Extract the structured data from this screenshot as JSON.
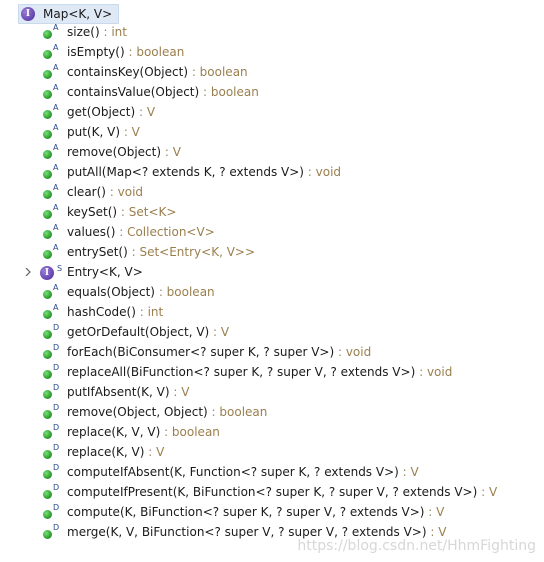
{
  "root": {
    "label": "Map<K, V>",
    "icon": "interface-icon"
  },
  "members": [
    {
      "badge": "A",
      "name": "size()",
      "sep": " : ",
      "type": "int",
      "kind": "method"
    },
    {
      "badge": "A",
      "name": "isEmpty()",
      "sep": " : ",
      "type": "boolean",
      "kind": "method"
    },
    {
      "badge": "A",
      "name": "containsKey(Object)",
      "sep": " : ",
      "type": "boolean",
      "kind": "method"
    },
    {
      "badge": "A",
      "name": "containsValue(Object)",
      "sep": " : ",
      "type": "boolean",
      "kind": "method"
    },
    {
      "badge": "A",
      "name": "get(Object)",
      "sep": " : ",
      "type": "V",
      "kind": "method"
    },
    {
      "badge": "A",
      "name": "put(K, V)",
      "sep": " : ",
      "type": "V",
      "kind": "method"
    },
    {
      "badge": "A",
      "name": "remove(Object)",
      "sep": " : ",
      "type": "V",
      "kind": "method"
    },
    {
      "badge": "A",
      "name": "putAll(Map<? extends K, ? extends V>)",
      "sep": " : ",
      "type": "void",
      "kind": "method"
    },
    {
      "badge": "A",
      "name": "clear()",
      "sep": " : ",
      "type": "void",
      "kind": "method"
    },
    {
      "badge": "A",
      "name": "keySet()",
      "sep": " : ",
      "type": "Set<K>",
      "kind": "method"
    },
    {
      "badge": "A",
      "name": "values()",
      "sep": " : ",
      "type": "Collection<V>",
      "kind": "method"
    },
    {
      "badge": "A",
      "name": "entrySet()",
      "sep": " : ",
      "type": "Set<Entry<K, V>>",
      "kind": "method"
    },
    {
      "badge": "S",
      "name": "Entry<K, V>",
      "sep": "",
      "type": "",
      "kind": "nested-interface"
    },
    {
      "badge": "A",
      "name": "equals(Object)",
      "sep": " : ",
      "type": "boolean",
      "kind": "method"
    },
    {
      "badge": "A",
      "name": "hashCode()",
      "sep": " : ",
      "type": "int",
      "kind": "method"
    },
    {
      "badge": "D",
      "name": "getOrDefault(Object, V)",
      "sep": " : ",
      "type": "V",
      "kind": "method"
    },
    {
      "badge": "D",
      "name": "forEach(BiConsumer<? super K, ? super V>)",
      "sep": " : ",
      "type": "void",
      "kind": "method"
    },
    {
      "badge": "D",
      "name": "replaceAll(BiFunction<? super K, ? super V, ? extends V>)",
      "sep": " : ",
      "type": "void",
      "kind": "method"
    },
    {
      "badge": "D",
      "name": "putIfAbsent(K, V)",
      "sep": " : ",
      "type": "V",
      "kind": "method"
    },
    {
      "badge": "D",
      "name": "remove(Object, Object)",
      "sep": " : ",
      "type": "boolean",
      "kind": "method"
    },
    {
      "badge": "D",
      "name": "replace(K, V, V)",
      "sep": " : ",
      "type": "boolean",
      "kind": "method"
    },
    {
      "badge": "D",
      "name": "replace(K, V)",
      "sep": " : ",
      "type": "V",
      "kind": "method"
    },
    {
      "badge": "D",
      "name": "computeIfAbsent(K, Function<? super K, ? extends V>)",
      "sep": " : ",
      "type": "V",
      "kind": "method"
    },
    {
      "badge": "D",
      "name": "computeIfPresent(K, BiFunction<? super K, ? super V, ? extends V>)",
      "sep": " : ",
      "type": "V",
      "kind": "method"
    },
    {
      "badge": "D",
      "name": "compute(K, BiFunction<? super K, ? super V, ? extends V>)",
      "sep": " : ",
      "type": "V",
      "kind": "method"
    },
    {
      "badge": "D",
      "name": "merge(K, V, BiFunction<? super V, ? super V, ? extends V>)",
      "sep": " : ",
      "type": "V",
      "kind": "method"
    }
  ],
  "watermark": "https://blog.csdn.net/HhmFighting",
  "colors": {
    "selection": "#dfe9f6",
    "method_dot": "#35a335",
    "interface_icon": "#6a4bb5",
    "return_type": "#9a7f4e"
  }
}
